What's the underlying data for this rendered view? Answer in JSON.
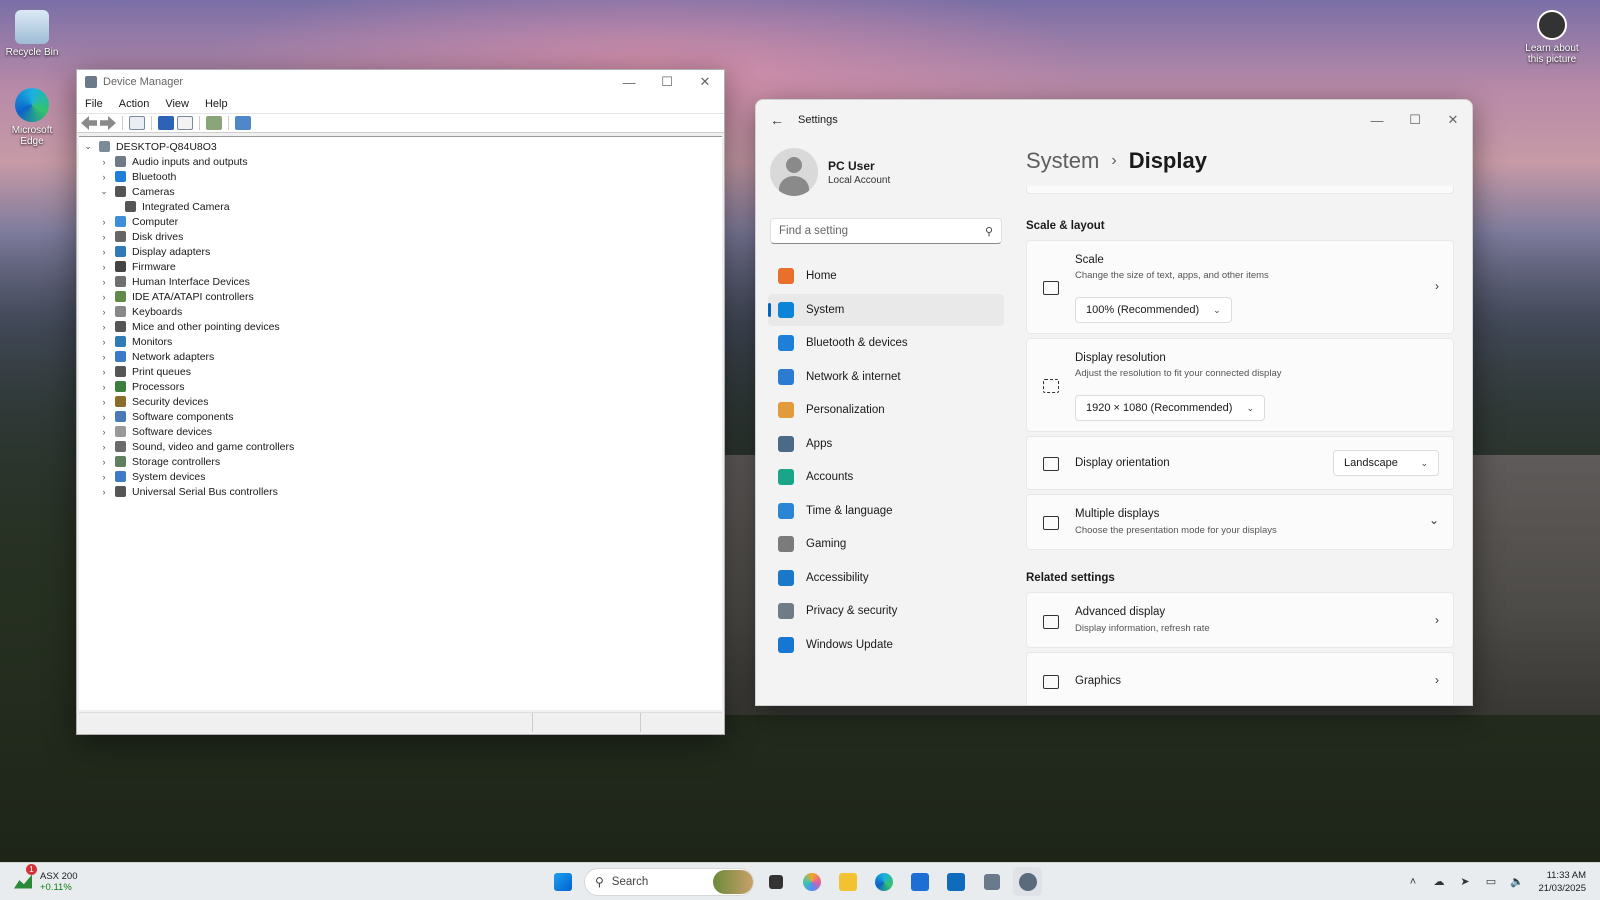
{
  "desktop": {
    "icons": [
      {
        "label": "Recycle Bin"
      },
      {
        "label": "Microsoft Edge"
      }
    ],
    "learn_about": "Learn about this picture"
  },
  "device_manager": {
    "title": "Device Manager",
    "menu": [
      "File",
      "Action",
      "View",
      "Help"
    ],
    "root": "DESKTOP-Q84U8O3",
    "categories": [
      {
        "label": "Audio inputs and outputs",
        "expanded": false
      },
      {
        "label": "Bluetooth",
        "expanded": false
      },
      {
        "label": "Cameras",
        "expanded": true
      },
      {
        "label": "Integrated Camera",
        "child": true
      },
      {
        "label": "Computer",
        "expanded": false
      },
      {
        "label": "Disk drives",
        "expanded": false
      },
      {
        "label": "Display adapters",
        "expanded": false
      },
      {
        "label": "Firmware",
        "expanded": false
      },
      {
        "label": "Human Interface Devices",
        "expanded": false
      },
      {
        "label": "IDE ATA/ATAPI controllers",
        "expanded": false
      },
      {
        "label": "Keyboards",
        "expanded": false
      },
      {
        "label": "Mice and other pointing devices",
        "expanded": false
      },
      {
        "label": "Monitors",
        "expanded": false
      },
      {
        "label": "Network adapters",
        "expanded": false
      },
      {
        "label": "Print queues",
        "expanded": false
      },
      {
        "label": "Processors",
        "expanded": false
      },
      {
        "label": "Security devices",
        "expanded": false
      },
      {
        "label": "Software components",
        "expanded": false
      },
      {
        "label": "Software devices",
        "expanded": false
      },
      {
        "label": "Sound, video and game controllers",
        "expanded": false
      },
      {
        "label": "Storage controllers",
        "expanded": false
      },
      {
        "label": "System devices",
        "expanded": false
      },
      {
        "label": "Universal Serial Bus controllers",
        "expanded": false
      }
    ]
  },
  "settings": {
    "title": "Settings",
    "user": {
      "name": "PC User",
      "account": "Local Account"
    },
    "search_placeholder": "Find a setting",
    "nav": [
      {
        "label": "Home",
        "icon": "home-icon",
        "color": "#e8702a"
      },
      {
        "label": "System",
        "icon": "system-icon",
        "color": "#0a84d6",
        "active": true
      },
      {
        "label": "Bluetooth & devices",
        "icon": "bluetooth-icon",
        "color": "#1e7fd8"
      },
      {
        "label": "Network & internet",
        "icon": "wifi-icon",
        "color": "#2b7bd1"
      },
      {
        "label": "Personalization",
        "icon": "brush-icon",
        "color": "#e39a3b"
      },
      {
        "label": "Apps",
        "icon": "apps-icon",
        "color": "#4a6a88"
      },
      {
        "label": "Accounts",
        "icon": "accounts-icon",
        "color": "#1aa58a"
      },
      {
        "label": "Time & language",
        "icon": "globe-clock-icon",
        "color": "#2a86d4"
      },
      {
        "label": "Gaming",
        "icon": "gamepad-icon",
        "color": "#7b7b7b"
      },
      {
        "label": "Accessibility",
        "icon": "accessibility-icon",
        "color": "#1b78c8"
      },
      {
        "label": "Privacy & security",
        "icon": "shield-icon",
        "color": "#6f7b86"
      },
      {
        "label": "Windows Update",
        "icon": "update-icon",
        "color": "#1677d2"
      }
    ],
    "breadcrumb": {
      "parent": "System",
      "current": "Display"
    },
    "section_scale_layout": "Scale & layout",
    "scale": {
      "title": "Scale",
      "desc": "Change the size of text, apps, and other items",
      "value": "100% (Recommended)"
    },
    "resolution": {
      "title": "Display resolution",
      "desc": "Adjust the resolution to fit your connected display",
      "value": "1920 × 1080 (Recommended)"
    },
    "orientation": {
      "title": "Display orientation",
      "value": "Landscape"
    },
    "multiple": {
      "title": "Multiple displays",
      "desc": "Choose the presentation mode for your displays"
    },
    "section_related": "Related settings",
    "advanced": {
      "title": "Advanced display",
      "desc": "Display information, refresh rate"
    },
    "graphics": {
      "title": "Graphics"
    }
  },
  "taskbar": {
    "weather": {
      "name": "ASX 200",
      "change": "+0.11%",
      "badge": "1"
    },
    "search_label": "Search",
    "time": "11:33 AM",
    "date": "21/03/2025"
  }
}
